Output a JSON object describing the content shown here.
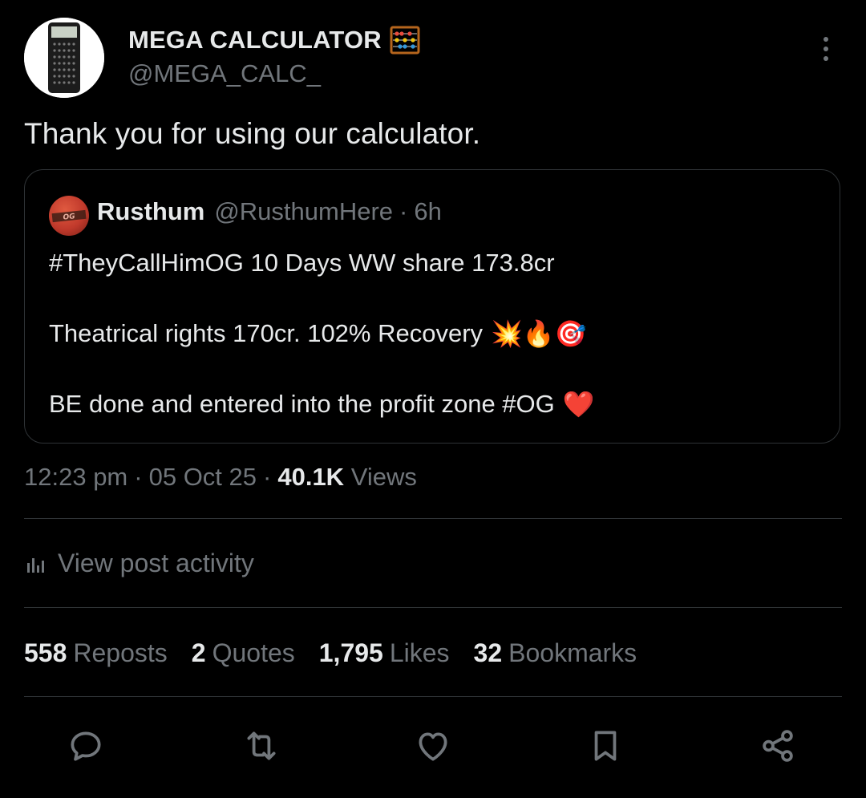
{
  "author": {
    "display_name": "MEGA CALCULATOR",
    "name_emoji_icon": "abacus-icon",
    "handle": "@MEGA_CALC_",
    "avatar_icon": "calculator-avatar"
  },
  "post": {
    "text": "Thank you for using our calculator."
  },
  "quote": {
    "name": "Rusthum",
    "handle": "@RusthumHere",
    "separator": "·",
    "time": "6h",
    "line1": "#TheyCallHimOG 10 Days WW share 173.8cr",
    "line2": "Theatrical rights 170cr. 102% Recovery",
    "line2_emojis": "💥🔥🎯",
    "line3": "BE done and entered into the profit zone #OG",
    "line3_emoji": "❤️"
  },
  "meta": {
    "time": "12:23 pm",
    "sep": "·",
    "date": "05 Oct 25",
    "views_count": "40.1K",
    "views_label": "Views"
  },
  "activity": {
    "label": "View post activity"
  },
  "stats": {
    "reposts_count": "558",
    "reposts_label": "Reposts",
    "quotes_count": "2",
    "quotes_label": "Quotes",
    "likes_count": "1,795",
    "likes_label": "Likes",
    "bookmarks_count": "32",
    "bookmarks_label": "Bookmarks"
  },
  "actions": [
    "reply-icon",
    "repost-icon",
    "like-icon",
    "bookmark-icon",
    "share-icon"
  ],
  "colors": {
    "background": "#000000",
    "text": "#e7e9ea",
    "muted": "#71767b",
    "border": "#2f3336"
  }
}
